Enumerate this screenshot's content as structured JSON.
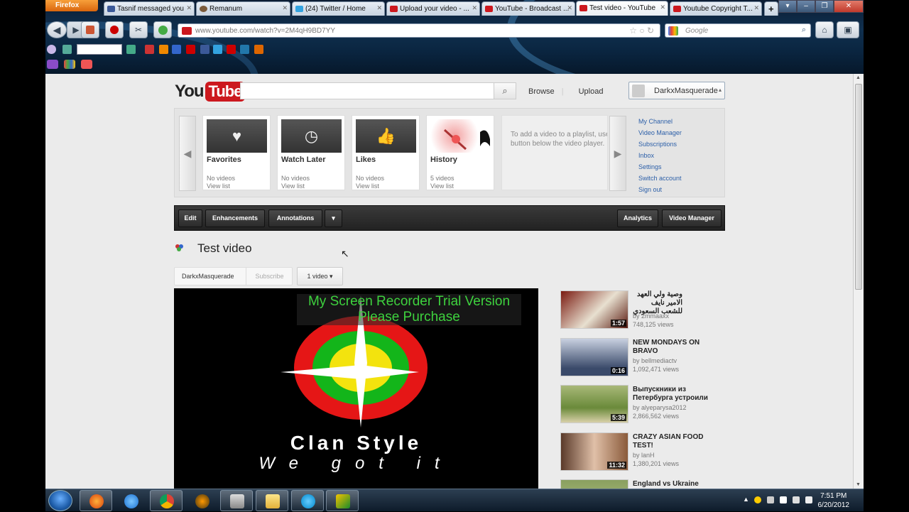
{
  "browser": {
    "app_button": "Firefox",
    "tabs": [
      {
        "label": "Tasnif messaged you",
        "fav": "#3b5998"
      },
      {
        "label": "Remanum",
        "fav": "#7a5a3a"
      },
      {
        "label": "(24) Twitter / Home",
        "fav": "#33a3e0"
      },
      {
        "label": "Upload your video - ...",
        "fav": "#cc181e"
      },
      {
        "label": "YouTube - Broadcast ...",
        "fav": "#cc181e"
      },
      {
        "label": "Test video - YouTube",
        "fav": "#cc181e"
      },
      {
        "label": "Youtube Copyright T...",
        "fav": "#cc181e"
      }
    ],
    "new_tab": "+",
    "url": "www.youtube.com/watch?v=2M4qH9BD7YY",
    "search_placeholder": "Google"
  },
  "masthead": {
    "logo_you": "You",
    "logo_tube": "Tube",
    "search_icon": "search-icon",
    "browse": "Browse",
    "upload": "Upload",
    "account": "DarkxMasquerade"
  },
  "guide": {
    "cards": [
      {
        "title": "Favorites",
        "count": "No videos",
        "link": "View list",
        "icon": "heart-icon",
        "glyph": "♥"
      },
      {
        "title": "Watch Later",
        "count": "No videos",
        "link": "View list",
        "icon": "clock-icon",
        "glyph": "◷"
      },
      {
        "title": "Likes",
        "count": "No videos",
        "link": "View list",
        "icon": "thumbs-up-icon",
        "glyph": "👍"
      },
      {
        "title": "History",
        "count": "5 videos",
        "link": "View list",
        "icon": "history-thumb",
        "glyph": ""
      }
    ],
    "tip": "To add a video to a playlist, use the\nbutton below the video player.",
    "links": [
      "My Channel",
      "Video Manager",
      "Subscriptions",
      "Inbox",
      "Settings",
      "Switch account",
      "Sign out"
    ]
  },
  "actions": {
    "edit": "Edit",
    "enhancements": "Enhancements",
    "annotations": "Annotations",
    "more": "▾",
    "analytics": "Analytics",
    "video_manager": "Video Manager"
  },
  "video": {
    "title": "Test video",
    "channel": "DarkxMasquerade",
    "subscribe": "Subscribe",
    "count": "1 video ▾",
    "caption1": "Clan Style",
    "caption2": "We got it",
    "watermark1": "My Screen Recorder Trial Version",
    "watermark2": "Please Purchase"
  },
  "related": [
    {
      "title": "وصية ولي العهد الامير نايف للشعب السعودي",
      "by": "by 2mmaaxx",
      "views": "748,125 views",
      "dur": "1:57",
      "c1": "#7a1a10",
      "c2": "#e8e0d0"
    },
    {
      "title": "NEW MONDAYS ON BRAVO",
      "by": "by bellmediactv",
      "views": "1,092,471 views",
      "dur": "0:16",
      "c1": "#2a3a5a",
      "c2": "#c8d0e0"
    },
    {
      "title": "Выпускники из Петербурга устроили",
      "by": "by alyeparysa2012",
      "views": "2,866,562 views",
      "dur": "5:39",
      "c1": "#6a8a3a",
      "c2": "#d8d0a8"
    },
    {
      "title": "CRAZY ASIAN FOOD TEST!",
      "by": "by lanH",
      "views": "1,380,201 views",
      "dur": "11:32",
      "c1": "#5a3a2a",
      "c2": "#e0c0a8"
    },
    {
      "title": "England vs Ukraine",
      "by": "",
      "views": "",
      "dur": "",
      "c1": "#8aa060",
      "c2": "#b0c080"
    }
  ],
  "taskbar": {
    "time": "7:51 PM",
    "date": "6/20/2012",
    "apps": [
      "firefox-icon",
      "ie-icon",
      "chrome-icon",
      "media-icon",
      "video-app-icon",
      "explorer-icon",
      "skype-icon",
      "recorder-icon"
    ]
  }
}
